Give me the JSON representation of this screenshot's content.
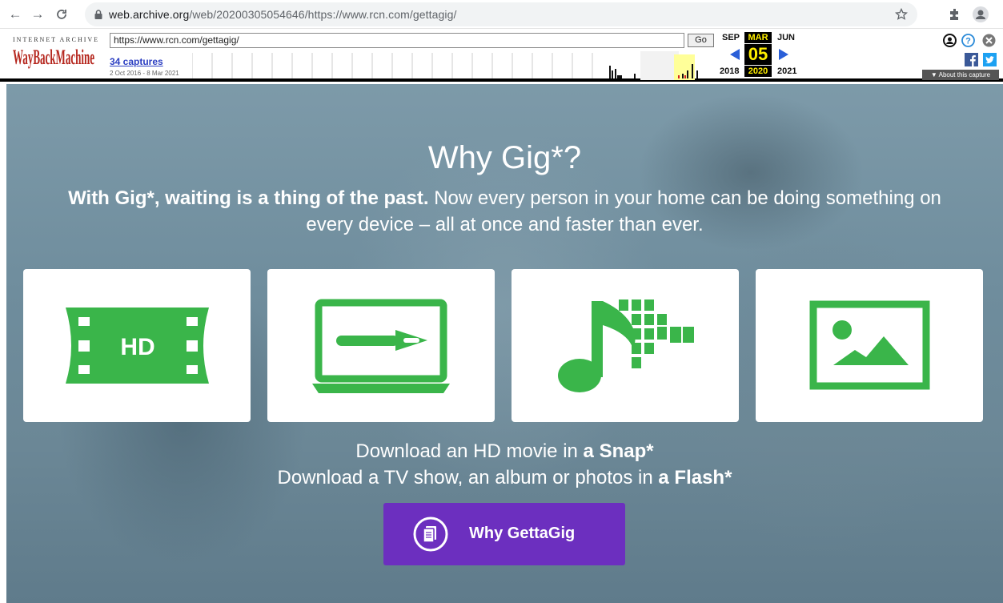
{
  "browser": {
    "url_host": "web.archive.org",
    "url_path": "/web/20200305054646/https://www.rcn.com/gettagig/"
  },
  "wayback": {
    "logo_top": "INTERNET ARCHIVE",
    "logo_text": "WayBackMachine",
    "url_value": "https://www.rcn.com/gettagig/",
    "go_label": "Go",
    "captures_label": "34 captures",
    "date_range": "2 Oct 2016 - 8 Mar 2021",
    "month_prev": "SEP",
    "month_cur": "MAR",
    "month_next": "JUN",
    "day": "05",
    "year_prev": "2018",
    "year_cur": "2020",
    "year_next": "2021",
    "about_label": "▼ About this capture"
  },
  "hero": {
    "title": "Why Gig*?",
    "subtitle_bold": "With Gig*, waiting is a thing of the past.",
    "subtitle_rest": " Now every person in your home can be doing something on every device – all at once and faster than ever.",
    "cards": [
      {
        "icon": "hd-film-icon"
      },
      {
        "icon": "laptop-download-icon"
      },
      {
        "icon": "music-grid-icon"
      },
      {
        "icon": "photo-icon"
      }
    ],
    "line1_text": "Download an HD movie in ",
    "line1_bold": "a Snap*",
    "line2_text": "Download a TV show, an album or photos in ",
    "line2_bold": "a Flash*",
    "cta_label": "Why GettaGig",
    "hd_text": "HD"
  },
  "colors": {
    "icon_green": "#3ab54a",
    "cta_purple": "#6c2fbf",
    "wayback_yellow": "#ffef00"
  }
}
